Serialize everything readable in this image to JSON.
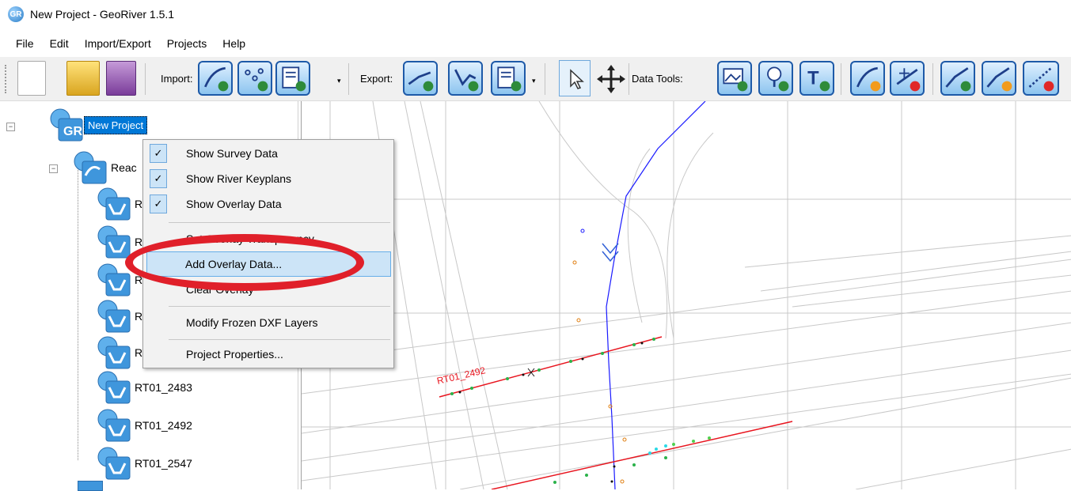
{
  "window": {
    "title": "New Project - GeoRiver 1.5.1",
    "app_icon": "georiver-icon"
  },
  "menu": [
    "File",
    "Edit",
    "Import/Export",
    "Projects",
    "Help"
  ],
  "toolbar": {
    "import_label": "Import:",
    "export_label": "Export:",
    "data_tools_label": "Data Tools:"
  },
  "tree": {
    "project_label": "New Project",
    "project_icon_text": "GR",
    "reach_label": "Reac",
    "partial_labels": [
      "R",
      "R",
      "R",
      "R",
      "R"
    ],
    "cross_sections": [
      "RT01_2483",
      "RT01_2492",
      "RT01_2547"
    ]
  },
  "context_menu": {
    "items": [
      {
        "label": "Show Survey Data",
        "checked": true
      },
      {
        "label": "Show River Keyplans",
        "checked": true
      },
      {
        "label": "Show Overlay Data",
        "checked": true
      },
      {
        "label": "Set Overlay Transparency",
        "checked": false
      },
      {
        "label": "Add Overlay Data...",
        "checked": false,
        "highlighted": true
      },
      {
        "label": "Clear Overlay",
        "checked": false
      },
      {
        "label": "Modify Frozen DXF Layers",
        "checked": false
      },
      {
        "label": "Project Properties...",
        "checked": false
      }
    ]
  },
  "map": {
    "section_label": "RT01_2492",
    "river_color": "#1a1aff",
    "section_color": "#e8141e"
  },
  "colors": {
    "highlight": "#0078d7",
    "annotation_ring": "#e0202a"
  }
}
